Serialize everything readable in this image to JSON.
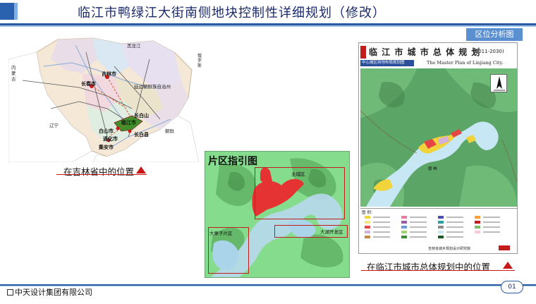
{
  "header": {
    "title": "临江市鸭绿江大街南侧地块控制性详细规划（修改）",
    "section_tag": "区位分析图"
  },
  "province_map": {
    "caption": "在吉林省中的位置",
    "labels": {
      "heilongjiang": "黑龙江",
      "neimenggu": "内蒙古",
      "liaoning": "辽宁",
      "changchun": "长春市",
      "jilin": "吉林市",
      "baishan_mtn": "长白山",
      "baishan_city": "白山市",
      "changbai": "长白县",
      "linjiang": "临江市",
      "tonghua": "通化市",
      "jian": "集安市",
      "chaoxian": "朝鲜",
      "eluosi": "俄罗斯",
      "yanbian": "延边朝鲜族自治州"
    }
  },
  "district_map": {
    "title": "片区指引图",
    "zones": {
      "main": "主城区",
      "dali": "大栗子片区",
      "dahu": "大湖开发区"
    }
  },
  "master_plan": {
    "title_cn": "临 江 市 城 市 总 体 规 划",
    "years": "(2011-2030)",
    "subtitle": "中心城区用地布局规划图",
    "title_en": "The Master Plan of Linjiang City.",
    "region_label": "朝 鲜",
    "legend_title": "图    例：",
    "institute": "吉林省城乡规划设计研究院",
    "caption": "在临江市城市总体规划中的位置"
  },
  "footer": {
    "company": "中天设计集团有限公司",
    "page": "01"
  },
  "colors": {
    "title_blue": "#1b2a6b",
    "rule_blue": "#2d5aa3",
    "caption_red": "#c81818",
    "zone_red": "#e53232"
  }
}
